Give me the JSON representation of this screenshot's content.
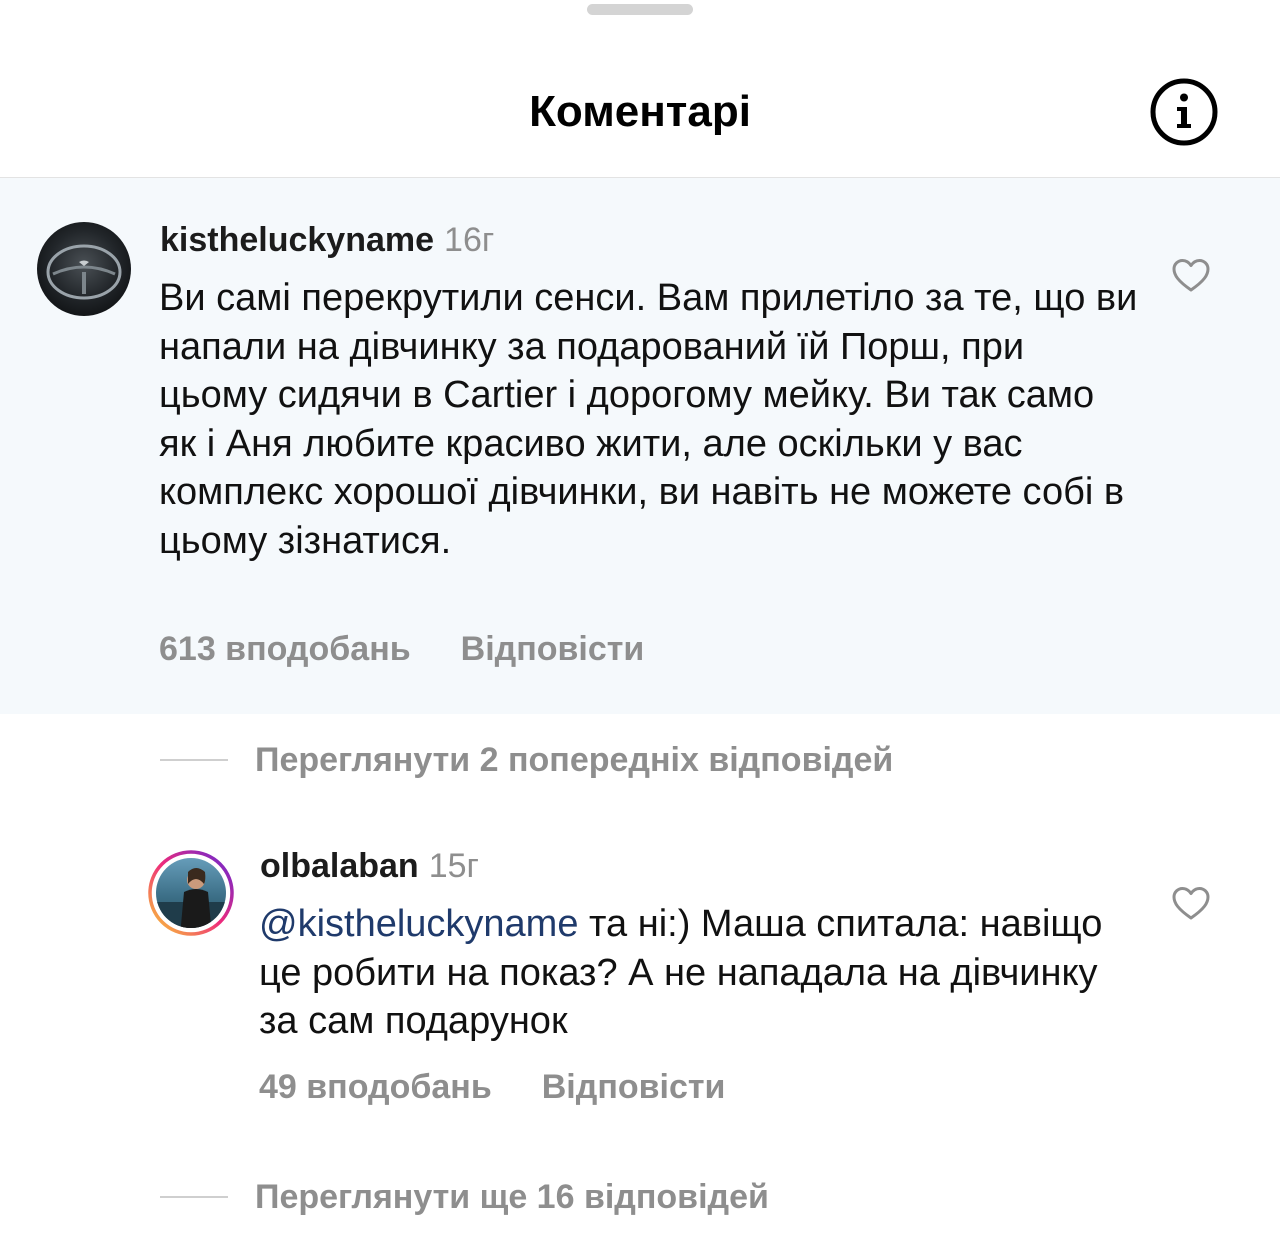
{
  "header": {
    "title": "Коментарі",
    "info_icon": "info-icon"
  },
  "comments": [
    {
      "username": "kistheluckyname",
      "time": "16г",
      "text": "Ви самі перекрутили сенси. Вам прилетіло за те, що ви напали на дівчинку за подарований їй Порш, при цьому сидячи в Cartier і дорогому мейку. Ви так само як і Аня любите красиво жити, але оскільки у вас комплекс хорошої дівчинки, ви навіть не можете собі в цьому зізнатися.",
      "likes": "613 вподобань",
      "reply": "Відповісти"
    },
    {
      "username": "olbalaban",
      "time": "15г",
      "mention": "@kistheluckyname",
      "text": " та ні:) Маша спитала: навіщо це робити на показ? А не нападала на дівчинку за сам подарунок",
      "likes": "49 вподобань",
      "reply": "Відповісти"
    }
  ],
  "view_previous": "Переглянути 2 попередніх відповідей",
  "view_more": "Переглянути ще 16 відповідей",
  "colors": {
    "highlight_bg": "#f5f9fc",
    "muted_text": "#8e8e8e",
    "mention": "#1f3a6b"
  }
}
